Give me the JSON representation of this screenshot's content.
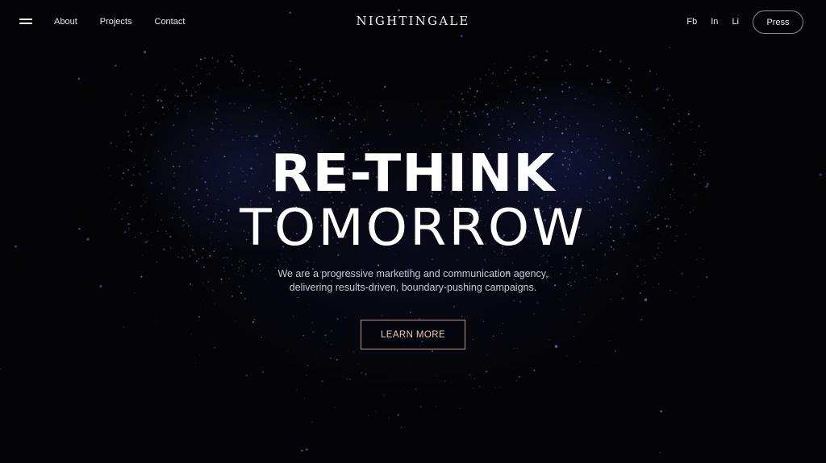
{
  "brand": {
    "name": "NIGHTINGALE"
  },
  "nav": {
    "left": [
      {
        "label": "About"
      },
      {
        "label": "Projects"
      },
      {
        "label": "Contact"
      }
    ],
    "social": [
      {
        "label": "Fb"
      },
      {
        "label": "In"
      },
      {
        "label": "Li"
      }
    ],
    "press_label": "Press"
  },
  "hero": {
    "headline_line1": "RE-THINK",
    "headline_line2": "TOMORROW",
    "subtitle_line1": "We are a progressive marketing and communication agency,",
    "subtitle_line2": "delivering results-driven, boundary-pushing campaigns.",
    "cta_label": "LEARN MORE"
  },
  "colors": {
    "background": "#040407",
    "text": "#ffffff",
    "accent_button_border": "#b79a86",
    "accent_button_text": "#e7cdb9",
    "glow": "#28378c"
  },
  "icons": {
    "menu": "hamburger-icon"
  }
}
